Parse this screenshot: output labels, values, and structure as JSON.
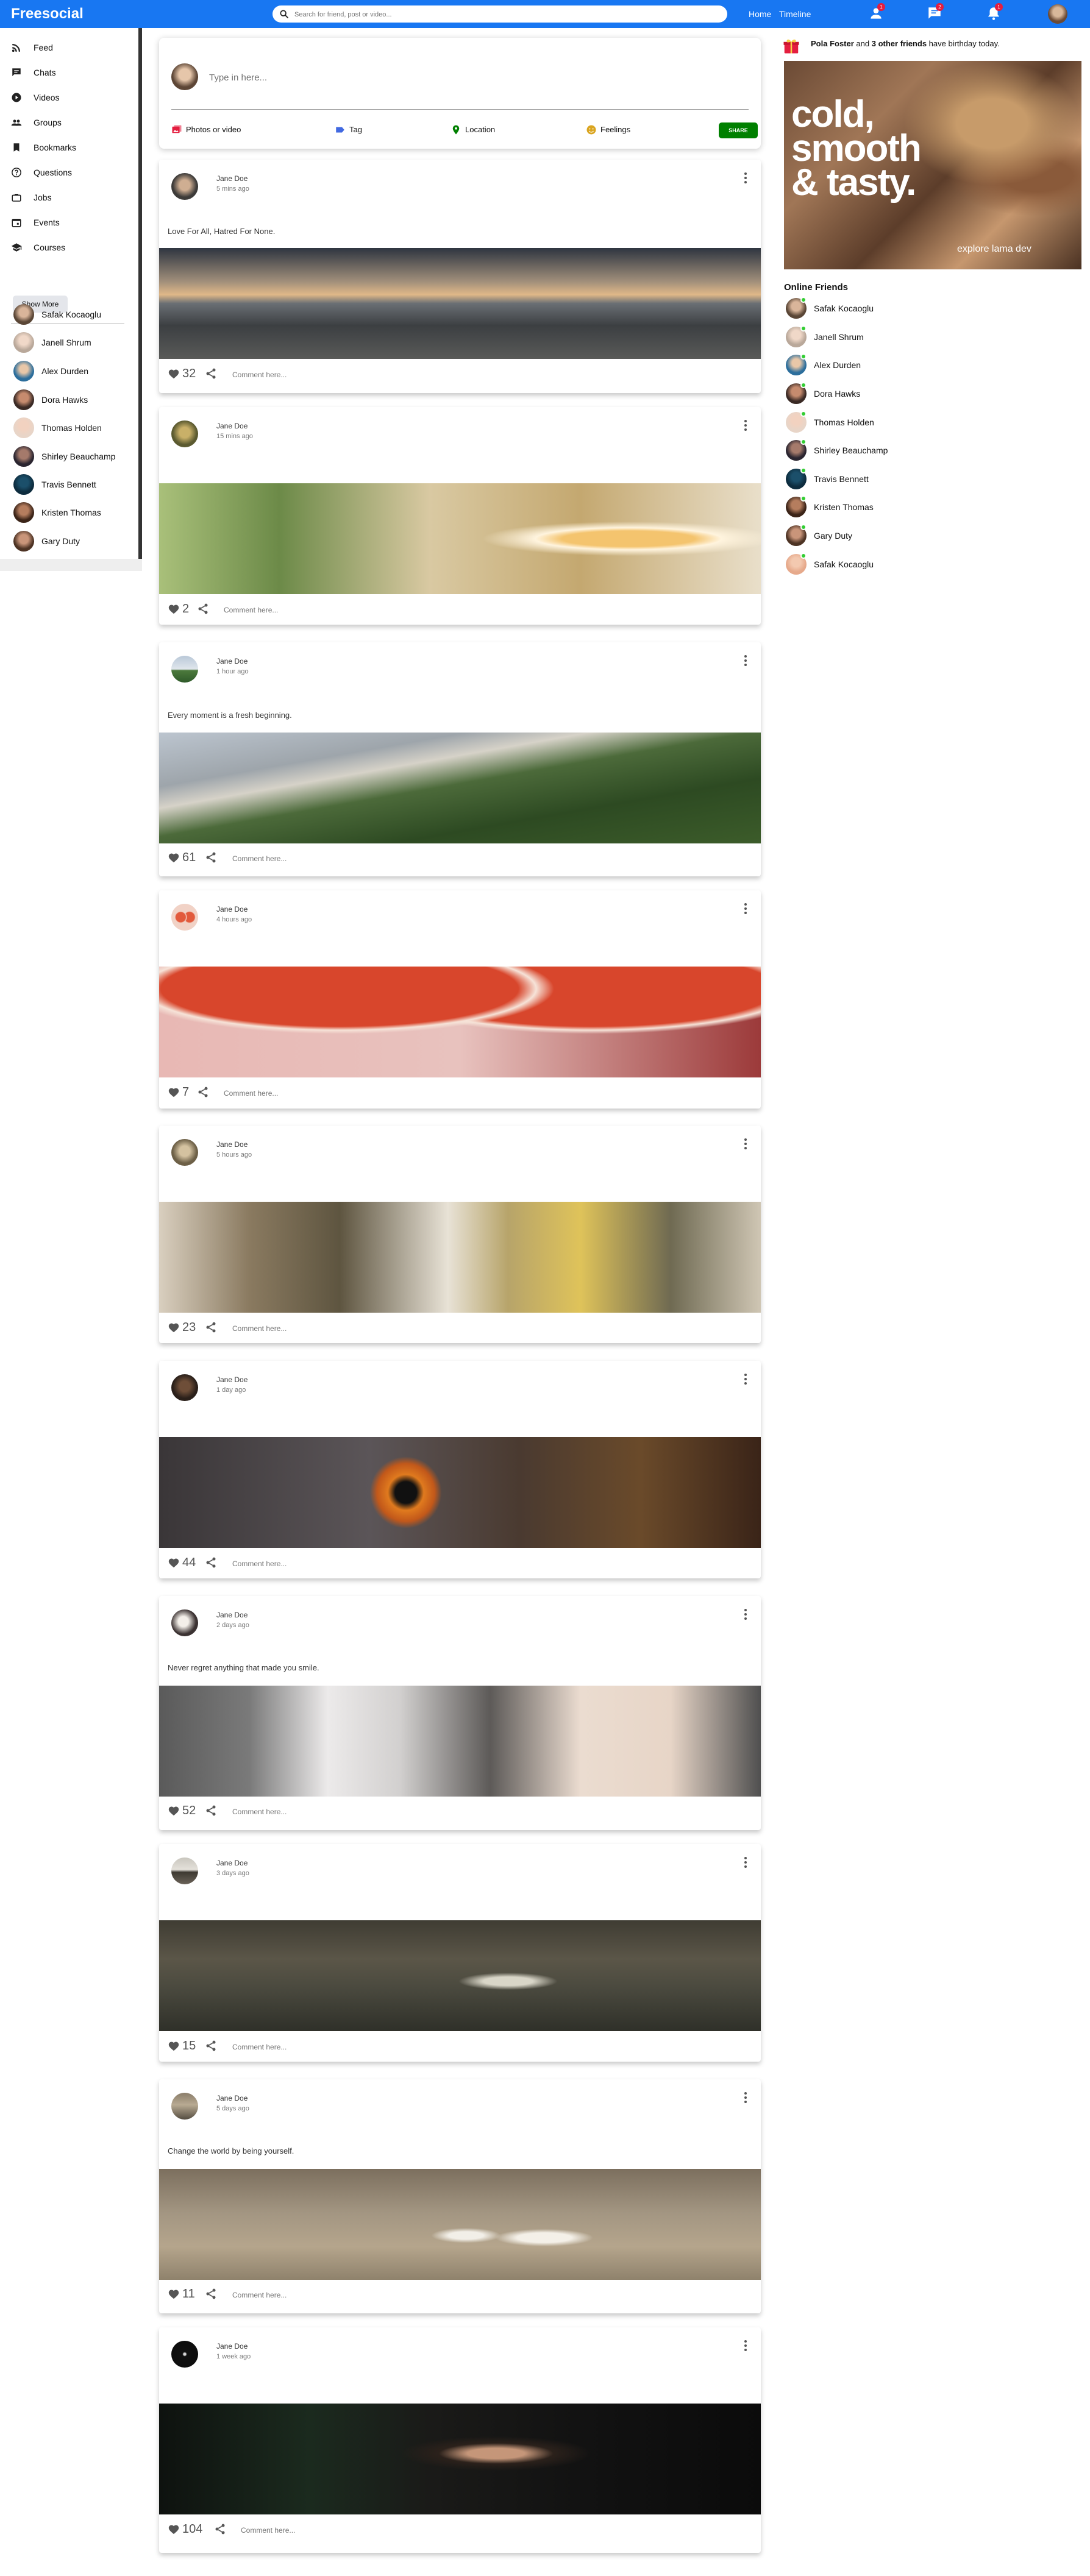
{
  "app": {
    "logo": "Freesocial"
  },
  "topbar": {
    "search_placeholder": "Search for friend, post or video...",
    "links": [
      "Home",
      "Timeline"
    ],
    "badges": {
      "friends": "1",
      "messages": "2",
      "notifications": "1"
    }
  },
  "sidebar": {
    "items": [
      {
        "label": "Feed",
        "icon": "rss-icon"
      },
      {
        "label": "Chats",
        "icon": "chat-icon"
      },
      {
        "label": "Videos",
        "icon": "play-circle-icon"
      },
      {
        "label": "Groups",
        "icon": "group-icon"
      },
      {
        "label": "Bookmarks",
        "icon": "bookmark-icon"
      },
      {
        "label": "Questions",
        "icon": "help-icon"
      },
      {
        "label": "Jobs",
        "icon": "briefcase-icon"
      },
      {
        "label": "Events",
        "icon": "calendar-icon"
      },
      {
        "label": "Courses",
        "icon": "school-icon"
      }
    ],
    "show_more": "Show More",
    "friends": [
      "Safak Kocaoglu",
      "Janell Shrum",
      "Alex Durden",
      "Dora Hawks",
      "Thomas Holden",
      "Shirley Beauchamp",
      "Travis Bennett",
      "Kristen Thomas",
      "Gary Duty"
    ]
  },
  "share": {
    "placeholder": "Type in here...",
    "options": [
      "Photos or video",
      "Tag",
      "Location",
      "Feelings"
    ],
    "button": "SHARE",
    "colors": {
      "photo": "#e41e3f",
      "tag": "#4169e1",
      "location": "#008000",
      "feelings": "#daa520",
      "button": "#008000"
    }
  },
  "posts": [
    {
      "name": "Jane Doe",
      "time": "5 mins ago",
      "text": "Love For All, Hatred For None.",
      "likes": "32",
      "image": "train station platform",
      "comment": "Comment here..."
    },
    {
      "name": "Jane Doe",
      "time": "15 mins ago",
      "text": "",
      "likes": "2",
      "image": "ramen bowl with egg and shrimp",
      "comment": "Comment here..."
    },
    {
      "name": "Jane Doe",
      "time": "1 hour ago",
      "text": "Every moment is a fresh beginning.",
      "likes": "61",
      "image": "mountain forest landscape",
      "comment": "Comment here..."
    },
    {
      "name": "Jane Doe",
      "time": "4 hours ago",
      "text": "",
      "likes": "7",
      "image": "halved grapefruits",
      "comment": "Comment here..."
    },
    {
      "name": "Jane Doe",
      "time": "5 hours ago",
      "text": "",
      "likes": "23",
      "image": "people in cafe with flowers",
      "comment": "Comment here..."
    },
    {
      "name": "Jane Doe",
      "time": "1 day ago",
      "text": "",
      "likes": "44",
      "image": "cat eye close-up",
      "comment": "Comment here..."
    },
    {
      "name": "Jane Doe",
      "time": "2 days ago",
      "text": "Never regret anything that made you smile.",
      "likes": "52",
      "image": "two children on sofa",
      "comment": "Comment here..."
    },
    {
      "name": "Jane Doe",
      "time": "3 days ago",
      "text": "",
      "likes": "15",
      "image": "dark valley with lake",
      "comment": "Comment here..."
    },
    {
      "name": "Jane Doe",
      "time": "5 days ago",
      "text": "Change the world by being yourself.",
      "likes": "11",
      "image": "couple walking hand in hand",
      "comment": "Comment here..."
    },
    {
      "name": "Jane Doe",
      "time": "1 week ago",
      "text": "",
      "likes": "104",
      "image": "man smoking in dark room",
      "comment": "Comment here..."
    }
  ],
  "rightbar": {
    "birthday_name": "Pola Foster",
    "birthday_and": "and",
    "birthday_others": "3 other friends",
    "birthday_suffix": "have birthday today.",
    "ad_title": "cold,\nsmooth\n& tasty.",
    "ad_footer": "explore lama dev",
    "online_title": "Online Friends",
    "online_friends": [
      "Safak Kocaoglu",
      "Janell Shrum",
      "Alex Durden",
      "Dora Hawks",
      "Thomas Holden",
      "Shirley Beauchamp",
      "Travis Bennett",
      "Kristen Thomas",
      "Gary Duty",
      "Safak Kocaoglu"
    ]
  },
  "colors": {
    "topbar": "#1877f2",
    "online_dot": "#32cd32",
    "badge": "#e41e3f"
  }
}
